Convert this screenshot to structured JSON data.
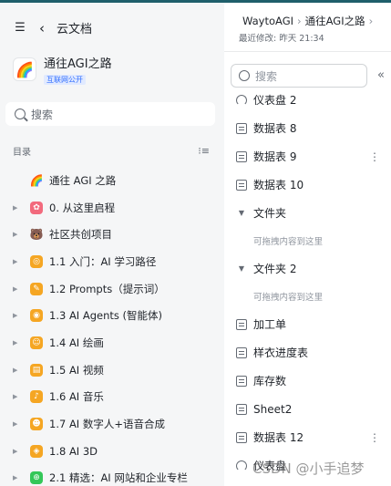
{
  "left": {
    "header": {
      "title": "云文档",
      "collapse_icon": "sidebar-collapse-icon",
      "back_icon": "chevron-left-icon"
    },
    "workspace": {
      "name": "通往AGI之路",
      "badge": "互联网公开",
      "logo_icon": "rainbow-icon"
    },
    "search": {
      "placeholder": "搜索"
    },
    "toc": {
      "label": "目录"
    },
    "tree": [
      {
        "label": "通往 AGI 之路",
        "icon": "rainbow-icon",
        "glyph": "🌈",
        "color": "plain",
        "arrow": false
      },
      {
        "label": "0. 从这里启程",
        "icon": "doc-icon",
        "glyph": "✿",
        "color": "pink",
        "arrow": true
      },
      {
        "label": "社区共创项目",
        "icon": "bear-icon",
        "glyph": "🐻",
        "color": "plain",
        "arrow": true
      },
      {
        "label": "1.1 入门：AI 学习路径",
        "icon": "doc-icon",
        "glyph": "◎",
        "color": "orange",
        "arrow": true
      },
      {
        "label": "1.2 Prompts（提示词）",
        "icon": "doc-icon",
        "glyph": "✎",
        "color": "orange",
        "arrow": true
      },
      {
        "label": "1.3 AI Agents (智能体)",
        "icon": "doc-icon",
        "glyph": "◉",
        "color": "orange",
        "arrow": true
      },
      {
        "label": "1.4 AI 绘画",
        "icon": "doc-icon",
        "glyph": "☺",
        "color": "orange",
        "arrow": true
      },
      {
        "label": "1.5 AI 视频",
        "icon": "doc-icon",
        "glyph": "▤",
        "color": "orange",
        "arrow": true
      },
      {
        "label": "1.6 AI 音乐",
        "icon": "doc-icon",
        "glyph": "♪",
        "color": "orange",
        "arrow": true
      },
      {
        "label": "1.7 AI 数字人+语音合成",
        "icon": "doc-icon",
        "glyph": "☻",
        "color": "orange",
        "arrow": true
      },
      {
        "label": "1.8 AI 3D",
        "icon": "doc-icon",
        "glyph": "◈",
        "color": "orange",
        "arrow": true
      },
      {
        "label": "2.1 精选：AI 网站和企业专栏",
        "icon": "doc-icon",
        "glyph": "⊕",
        "color": "green",
        "arrow": true
      }
    ]
  },
  "right": {
    "breadcrumb": [
      "WaytoAGI",
      "通往AGI之路"
    ],
    "last_modified": "最近修改: 昨天 21:34",
    "search": {
      "placeholder": "搜索"
    },
    "items": [
      {
        "type": "dashboard",
        "label": "仪表盘 2",
        "more": false
      },
      {
        "type": "table",
        "label": "数据表 8",
        "more": false
      },
      {
        "type": "table",
        "label": "数据表 9",
        "more": true
      },
      {
        "type": "table",
        "label": "数据表 10",
        "more": false
      },
      {
        "type": "folder",
        "label": "文件夹",
        "more": false
      },
      {
        "type": "hint",
        "label": "可拖拽内容到这里"
      },
      {
        "type": "folder",
        "label": "文件夹 2",
        "more": false
      },
      {
        "type": "hint",
        "label": "可拖拽内容到这里"
      },
      {
        "type": "table",
        "label": "加工单",
        "more": false
      },
      {
        "type": "table",
        "label": "样衣进度表",
        "more": false
      },
      {
        "type": "table",
        "label": "库存数",
        "more": false
      },
      {
        "type": "table",
        "label": "Sheet2",
        "more": false
      },
      {
        "type": "table",
        "label": "数据表 12",
        "more": true
      },
      {
        "type": "dashboard",
        "label": "仪表盘",
        "more": false
      }
    ]
  },
  "watermark": "CSDN @小手追梦"
}
